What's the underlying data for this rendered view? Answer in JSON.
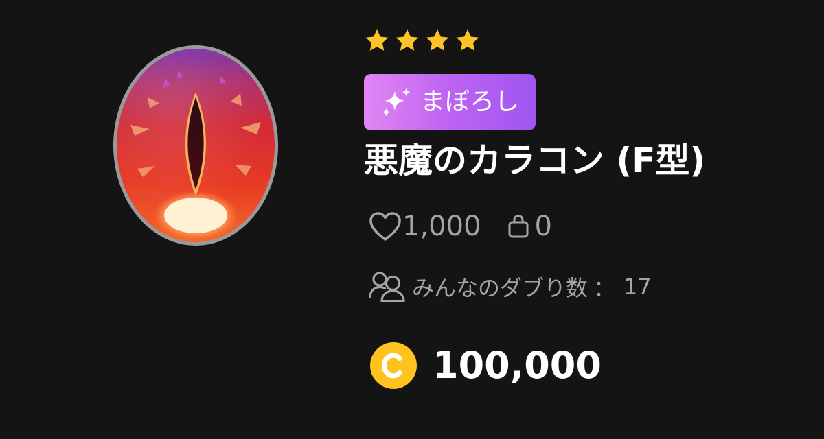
{
  "item": {
    "rarity_stars": 4,
    "rarity_label": "まぼろし",
    "name": "悪魔のカラコン (F型)",
    "likes": "1,000",
    "bag_count": "0",
    "duplicates_label": "みんなのダブり数",
    "duplicates_separator": "：",
    "duplicates_count": "17",
    "price": "100,000"
  },
  "icons": {
    "art": "demon-eye-contact-lens",
    "star": "star-icon",
    "badge": "sparkle-icon",
    "likes": "heart-icon",
    "bag": "shopping-bag-icon",
    "duplicates": "people-icon",
    "currency": "coin-icon"
  },
  "colors": {
    "background": "#141414",
    "star": "#ffc22b",
    "badge_gradient_start": "#e287f3",
    "badge_gradient_end": "#9f55f0",
    "muted_text": "#a4a4a4",
    "coin": "#ffc21e",
    "coin_text": "#ffffff"
  }
}
